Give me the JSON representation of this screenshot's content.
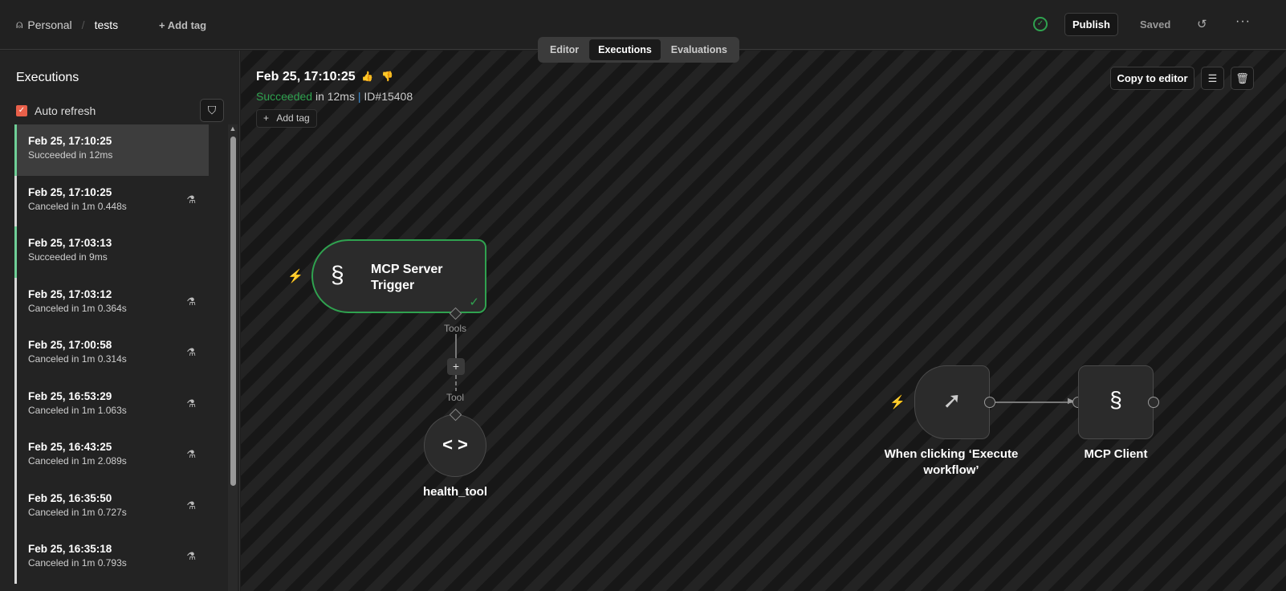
{
  "header": {
    "project": "Personal",
    "workflow": "tests",
    "add_tag": "+ Add tag",
    "publish": "Publish",
    "saved": "Saved"
  },
  "tabs": [
    "Editor",
    "Executions",
    "Evaluations"
  ],
  "sidebar": {
    "title": "Executions",
    "auto_refresh": "Auto refresh",
    "items": [
      {
        "time": "Feb 25, 17:10:25",
        "status": "Succeeded in 12ms",
        "state": "success",
        "selected": true
      },
      {
        "time": "Feb 25, 17:10:25",
        "status": "Canceled in 1m 0.448s",
        "state": "canceled"
      },
      {
        "time": "Feb 25, 17:03:13",
        "status": "Succeeded in 9ms",
        "state": "success"
      },
      {
        "time": "Feb 25, 17:03:12",
        "status": "Canceled in 1m 0.364s",
        "state": "canceled"
      },
      {
        "time": "Feb 25, 17:00:58",
        "status": "Canceled in 1m 0.314s",
        "state": "canceled"
      },
      {
        "time": "Feb 25, 16:53:29",
        "status": "Canceled in 1m 1.063s",
        "state": "canceled"
      },
      {
        "time": "Feb 25, 16:43:25",
        "status": "Canceled in 1m 2.089s",
        "state": "canceled"
      },
      {
        "time": "Feb 25, 16:35:50",
        "status": "Canceled in 1m 0.727s",
        "state": "canceled"
      },
      {
        "time": "Feb 25, 16:35:18",
        "status": "Canceled in 1m 0.793s",
        "state": "canceled"
      }
    ]
  },
  "execution": {
    "title": "Feb 25, 17:10:25",
    "status": "Succeeded",
    "duration": " in 12ms ",
    "id": "ID#15408",
    "add_tag": "Add tag",
    "copy_to_editor": "Copy to editor"
  },
  "nodes": {
    "mcp_trigger": "MCP Server Trigger",
    "tools_label": "Tools",
    "tool_label": "Tool",
    "health_tool": "health_tool",
    "manual_trigger": "When clicking ‘Execute workflow’",
    "mcp_client": "MCP Client"
  }
}
